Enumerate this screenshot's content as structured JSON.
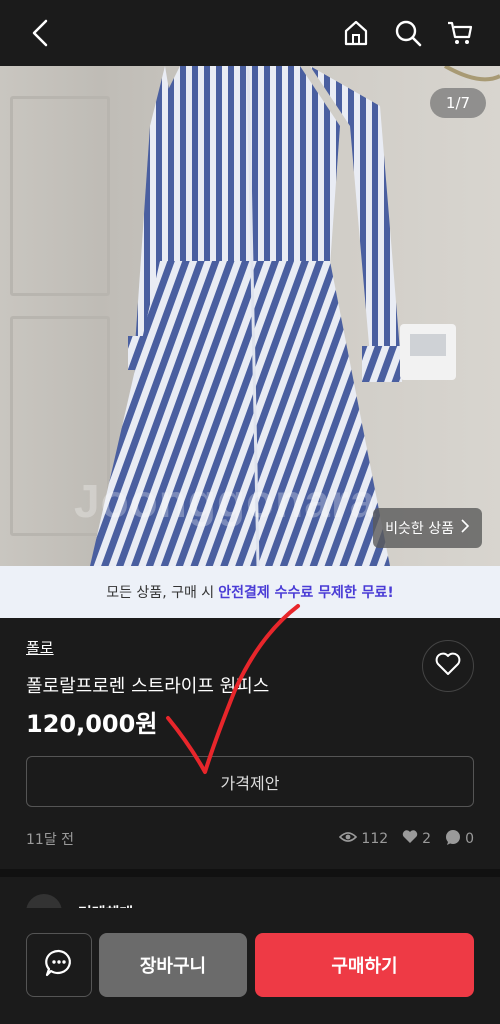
{
  "header": {
    "icons": [
      "back-arrow-icon",
      "home-icon",
      "search-icon",
      "cart-icon"
    ]
  },
  "image": {
    "counter": "1/7",
    "watermark": "Joonggonara",
    "similar_label": "비슷한 상품"
  },
  "promo": {
    "prefix": "모든 상품, 구매 시",
    "highlight": "안전결제 수수료 무제한 무료!"
  },
  "product": {
    "brand": "폴로",
    "title": "폴로랄프로렌 스트라이프 원피스",
    "price": "120,000원",
    "offer_label": "가격제안",
    "posted": "11달 전",
    "views": "112",
    "likes": "2",
    "chats": "0"
  },
  "seller": {
    "name": "겨레체대"
  },
  "bottom": {
    "cart_label": "장바구니",
    "buy_label": "구매하기"
  },
  "colors": {
    "accent": "#ee3a45",
    "promo_highlight": "#4a3cd6",
    "annotation_red": "#e8262b"
  }
}
